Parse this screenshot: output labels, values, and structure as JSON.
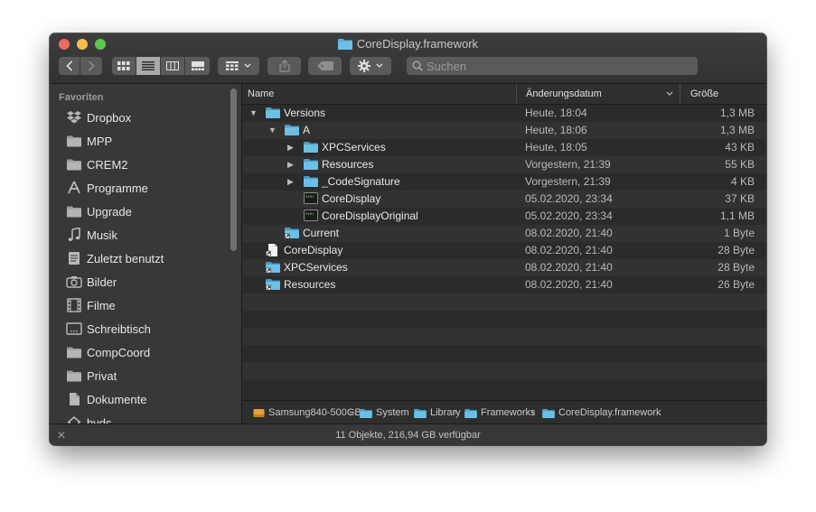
{
  "window": {
    "title": "CoreDisplay.framework"
  },
  "toolbar": {
    "back_label": "‹",
    "forward_label": "›",
    "search_placeholder": "Suchen"
  },
  "sidebar": {
    "heading": "Favoriten",
    "items": [
      {
        "label": "Dropbox",
        "icon": "dropbox-icon"
      },
      {
        "label": "MPP",
        "icon": "folder-icon"
      },
      {
        "label": "CREM2",
        "icon": "folder-icon"
      },
      {
        "label": "Programme",
        "icon": "applications-icon"
      },
      {
        "label": "Upgrade",
        "icon": "folder-icon"
      },
      {
        "label": "Musik",
        "icon": "music-note-icon"
      },
      {
        "label": "Zuletzt benutzt",
        "icon": "recents-icon"
      },
      {
        "label": "Bilder",
        "icon": "camera-icon"
      },
      {
        "label": "Filme",
        "icon": "film-icon"
      },
      {
        "label": "Schreibtisch",
        "icon": "desktop-icon"
      },
      {
        "label": "CompCoord",
        "icon": "folder-icon"
      },
      {
        "label": "Privat",
        "icon": "folder-icon"
      },
      {
        "label": "Dokumente",
        "icon": "document-icon"
      },
      {
        "label": "bvds",
        "icon": "home-icon"
      }
    ]
  },
  "columns": {
    "name": "Name",
    "date": "Änderungsdatum",
    "size": "Größe"
  },
  "files": [
    {
      "name": "Versions",
      "date": "Heute, 18:04",
      "size": "1,3 MB",
      "depth": 0,
      "expand": "open",
      "kind": "folder"
    },
    {
      "name": "A",
      "date": "Heute, 18:06",
      "size": "1,3 MB",
      "depth": 1,
      "expand": "open",
      "kind": "folder"
    },
    {
      "name": "XPCServices",
      "date": "Heute, 18:05",
      "size": "43 KB",
      "depth": 2,
      "expand": "closed",
      "kind": "folder"
    },
    {
      "name": "Resources",
      "date": "Vorgestern, 21:39",
      "size": "55 KB",
      "depth": 2,
      "expand": "closed",
      "kind": "folder"
    },
    {
      "name": "_CodeSignature",
      "date": "Vorgestern, 21:39",
      "size": "4 KB",
      "depth": 2,
      "expand": "closed",
      "kind": "folder"
    },
    {
      "name": "CoreDisplay",
      "date": "05.02.2020, 23:34",
      "size": "37 KB",
      "depth": 2,
      "expand": "none",
      "kind": "exec"
    },
    {
      "name": "CoreDisplayOriginal",
      "date": "05.02.2020, 23:34",
      "size": "1,1 MB",
      "depth": 2,
      "expand": "none",
      "kind": "exec"
    },
    {
      "name": "Current",
      "date": "08.02.2020, 21:40",
      "size": "1 Byte",
      "depth": 1,
      "expand": "none",
      "kind": "alias-folder"
    },
    {
      "name": "CoreDisplay",
      "date": "08.02.2020, 21:40",
      "size": "28 Byte",
      "depth": 0,
      "expand": "none",
      "kind": "alias-file"
    },
    {
      "name": "XPCServices",
      "date": "08.02.2020, 21:40",
      "size": "28 Byte",
      "depth": 0,
      "expand": "none",
      "kind": "alias-folder"
    },
    {
      "name": "Resources",
      "date": "08.02.2020, 21:40",
      "size": "26 Byte",
      "depth": 0,
      "expand": "none",
      "kind": "alias-folder"
    }
  ],
  "pathbar": [
    {
      "label": "Samsung840-500GB",
      "icon": "drive-icon"
    },
    {
      "label": "System",
      "icon": "folder-icon"
    },
    {
      "label": "Library",
      "icon": "folder-icon"
    },
    {
      "label": "Frameworks",
      "icon": "folder-icon"
    },
    {
      "label": "CoreDisplay.framework",
      "icon": "folder-icon"
    }
  ],
  "status": {
    "text": "11 Objekte, 216,94 GB verfügbar"
  },
  "colors": {
    "folder": "#5bb0d8",
    "window_bg": "#2b2b2b",
    "sidebar_bg": "#3a3837"
  }
}
